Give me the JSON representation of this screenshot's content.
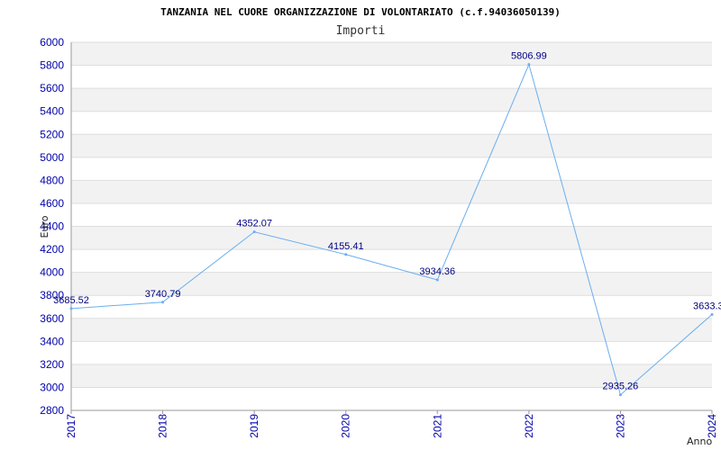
{
  "chart_data": {
    "type": "line",
    "title": "TANZANIA NEL CUORE ORGANIZZAZIONE DI VOLONTARIATO (c.f.94036050139)",
    "subtitle": "Importi",
    "ylabel": "Euro",
    "xlabel": "Anno",
    "ylim": [
      2800,
      6000
    ],
    "ystep": 200,
    "grid": true,
    "x": [
      "2017",
      "2018",
      "2019",
      "2020",
      "2021",
      "2022",
      "2023",
      "2024"
    ],
    "values": [
      3685.52,
      3740.79,
      4352.07,
      4155.41,
      3934.36,
      5806.99,
      2935.26,
      3633.3
    ],
    "labels": [
      "3685.52",
      "3740.79",
      "4352.07",
      "4155.41",
      "3934.36",
      "5806.99",
      "2935.26",
      "3633.3"
    ],
    "colors": {
      "line": "#6aaef0",
      "band": "#f2f2f2",
      "gridline": "#dddddd",
      "tick_text": "#0000aa",
      "data_label": "#000080"
    }
  }
}
